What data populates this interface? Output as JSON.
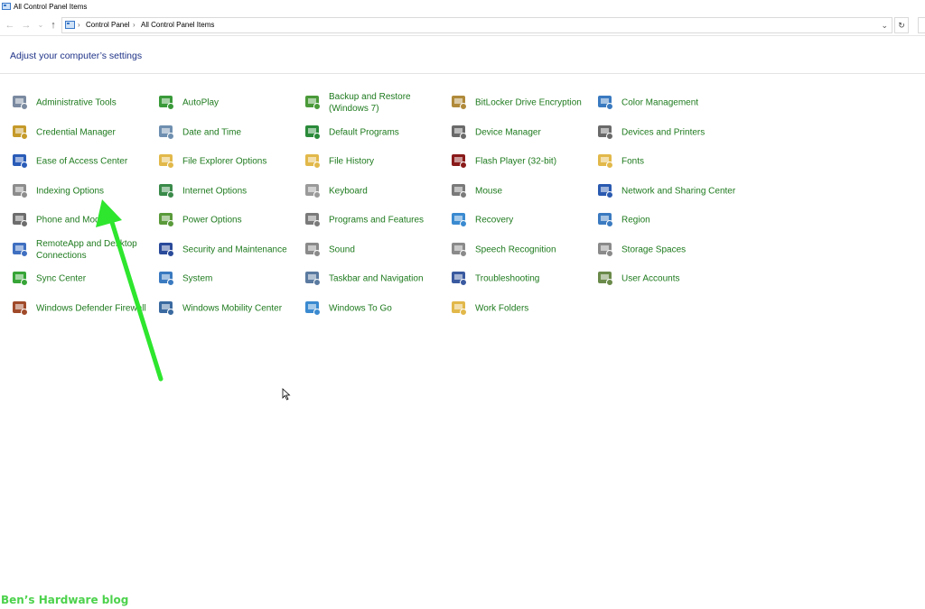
{
  "window": {
    "title": "All Control Panel Items"
  },
  "address": {
    "breadcrumb": [
      "Control Panel",
      "All Control Panel Items"
    ]
  },
  "heading": "Adjust your computer’s settings",
  "columns": [
    [
      {
        "label": "Administrative Tools",
        "icon": "administrative-tools-icon",
        "color": "#7a8aa0"
      },
      {
        "label": "Credential Manager",
        "icon": "credential-manager-icon",
        "color": "#c59a2a"
      },
      {
        "label": "Ease of Access Center",
        "icon": "ease-of-access-icon",
        "color": "#2a5cb8"
      },
      {
        "label": "Indexing Options",
        "icon": "indexing-options-icon",
        "color": "#8d8d8d"
      },
      {
        "label": "Phone and Modem",
        "icon": "phone-modem-icon",
        "color": "#6d6d6d"
      },
      {
        "label": "RemoteApp and Desktop Connections",
        "icon": "remoteapp-icon",
        "color": "#3f6fc0"
      },
      {
        "label": "Sync Center",
        "icon": "sync-center-icon",
        "color": "#37a537"
      },
      {
        "label": "Windows Defender Firewall",
        "icon": "firewall-icon",
        "color": "#a04a2a"
      }
    ],
    [
      {
        "label": "AutoPlay",
        "icon": "autoplay-icon",
        "color": "#3a9a3a"
      },
      {
        "label": "Date and Time",
        "icon": "date-time-icon",
        "color": "#6f8fb0"
      },
      {
        "label": "File Explorer Options",
        "icon": "file-explorer-options-icon",
        "color": "#e2b84a"
      },
      {
        "label": "Internet Options",
        "icon": "internet-options-icon",
        "color": "#3a8a4a"
      },
      {
        "label": "Power Options",
        "icon": "power-options-icon",
        "color": "#5a9a3a"
      },
      {
        "label": "Security and Maintenance",
        "icon": "security-maintenance-icon",
        "color": "#2a4a9a"
      },
      {
        "label": "System",
        "icon": "system-icon",
        "color": "#3a7ac0"
      },
      {
        "label": "Windows Mobility Center",
        "icon": "mobility-center-icon",
        "color": "#3a6aa0"
      }
    ],
    [
      {
        "label": "Backup and Restore (Windows 7)",
        "icon": "backup-restore-icon",
        "color": "#4a9a3a"
      },
      {
        "label": "Default Programs",
        "icon": "default-programs-icon",
        "color": "#2a8a3a"
      },
      {
        "label": "File History",
        "icon": "file-history-icon",
        "color": "#e2b84a"
      },
      {
        "label": "Keyboard",
        "icon": "keyboard-icon",
        "color": "#9a9a9a"
      },
      {
        "label": "Programs and Features",
        "icon": "programs-features-icon",
        "color": "#7a7a7a"
      },
      {
        "label": "Sound",
        "icon": "sound-icon",
        "color": "#8a8a8a"
      },
      {
        "label": "Taskbar and Navigation",
        "icon": "taskbar-navigation-icon",
        "color": "#5a7aa0"
      },
      {
        "label": "Windows To Go",
        "icon": "windows-to-go-icon",
        "color": "#3a8ad0"
      }
    ],
    [
      {
        "label": "BitLocker Drive Encryption",
        "icon": "bitlocker-icon",
        "color": "#b08a3a"
      },
      {
        "label": "Device Manager",
        "icon": "device-manager-icon",
        "color": "#6a6a6a"
      },
      {
        "label": "Flash Player (32-bit)",
        "icon": "flash-player-icon",
        "color": "#8a1a1a"
      },
      {
        "label": "Mouse",
        "icon": "mouse-icon",
        "color": "#7a7a7a"
      },
      {
        "label": "Recovery",
        "icon": "recovery-icon",
        "color": "#3a8ad0"
      },
      {
        "label": "Speech Recognition",
        "icon": "speech-recognition-icon",
        "color": "#8a8a8a"
      },
      {
        "label": "Troubleshooting",
        "icon": "troubleshooting-icon",
        "color": "#3a5aa0"
      },
      {
        "label": "Work Folders",
        "icon": "work-folders-icon",
        "color": "#e2b84a"
      }
    ],
    [
      {
        "label": "Color Management",
        "icon": "color-management-icon",
        "color": "#3a7ac0"
      },
      {
        "label": "Devices and Printers",
        "icon": "devices-printers-icon",
        "color": "#6a6a6a"
      },
      {
        "label": "Fonts",
        "icon": "fonts-icon",
        "color": "#e2b84a"
      },
      {
        "label": "Network and Sharing Center",
        "icon": "network-sharing-icon",
        "color": "#2a5ab0"
      },
      {
        "label": "Region",
        "icon": "region-icon",
        "color": "#3a7ac0"
      },
      {
        "label": "Storage Spaces",
        "icon": "storage-spaces-icon",
        "color": "#8a8a8a"
      },
      {
        "label": "User Accounts",
        "icon": "user-accounts-icon",
        "color": "#6a8a4a"
      }
    ]
  ],
  "watermark": "Ben’s Hardware blog",
  "annotation": {
    "color": "#2ee62e"
  }
}
